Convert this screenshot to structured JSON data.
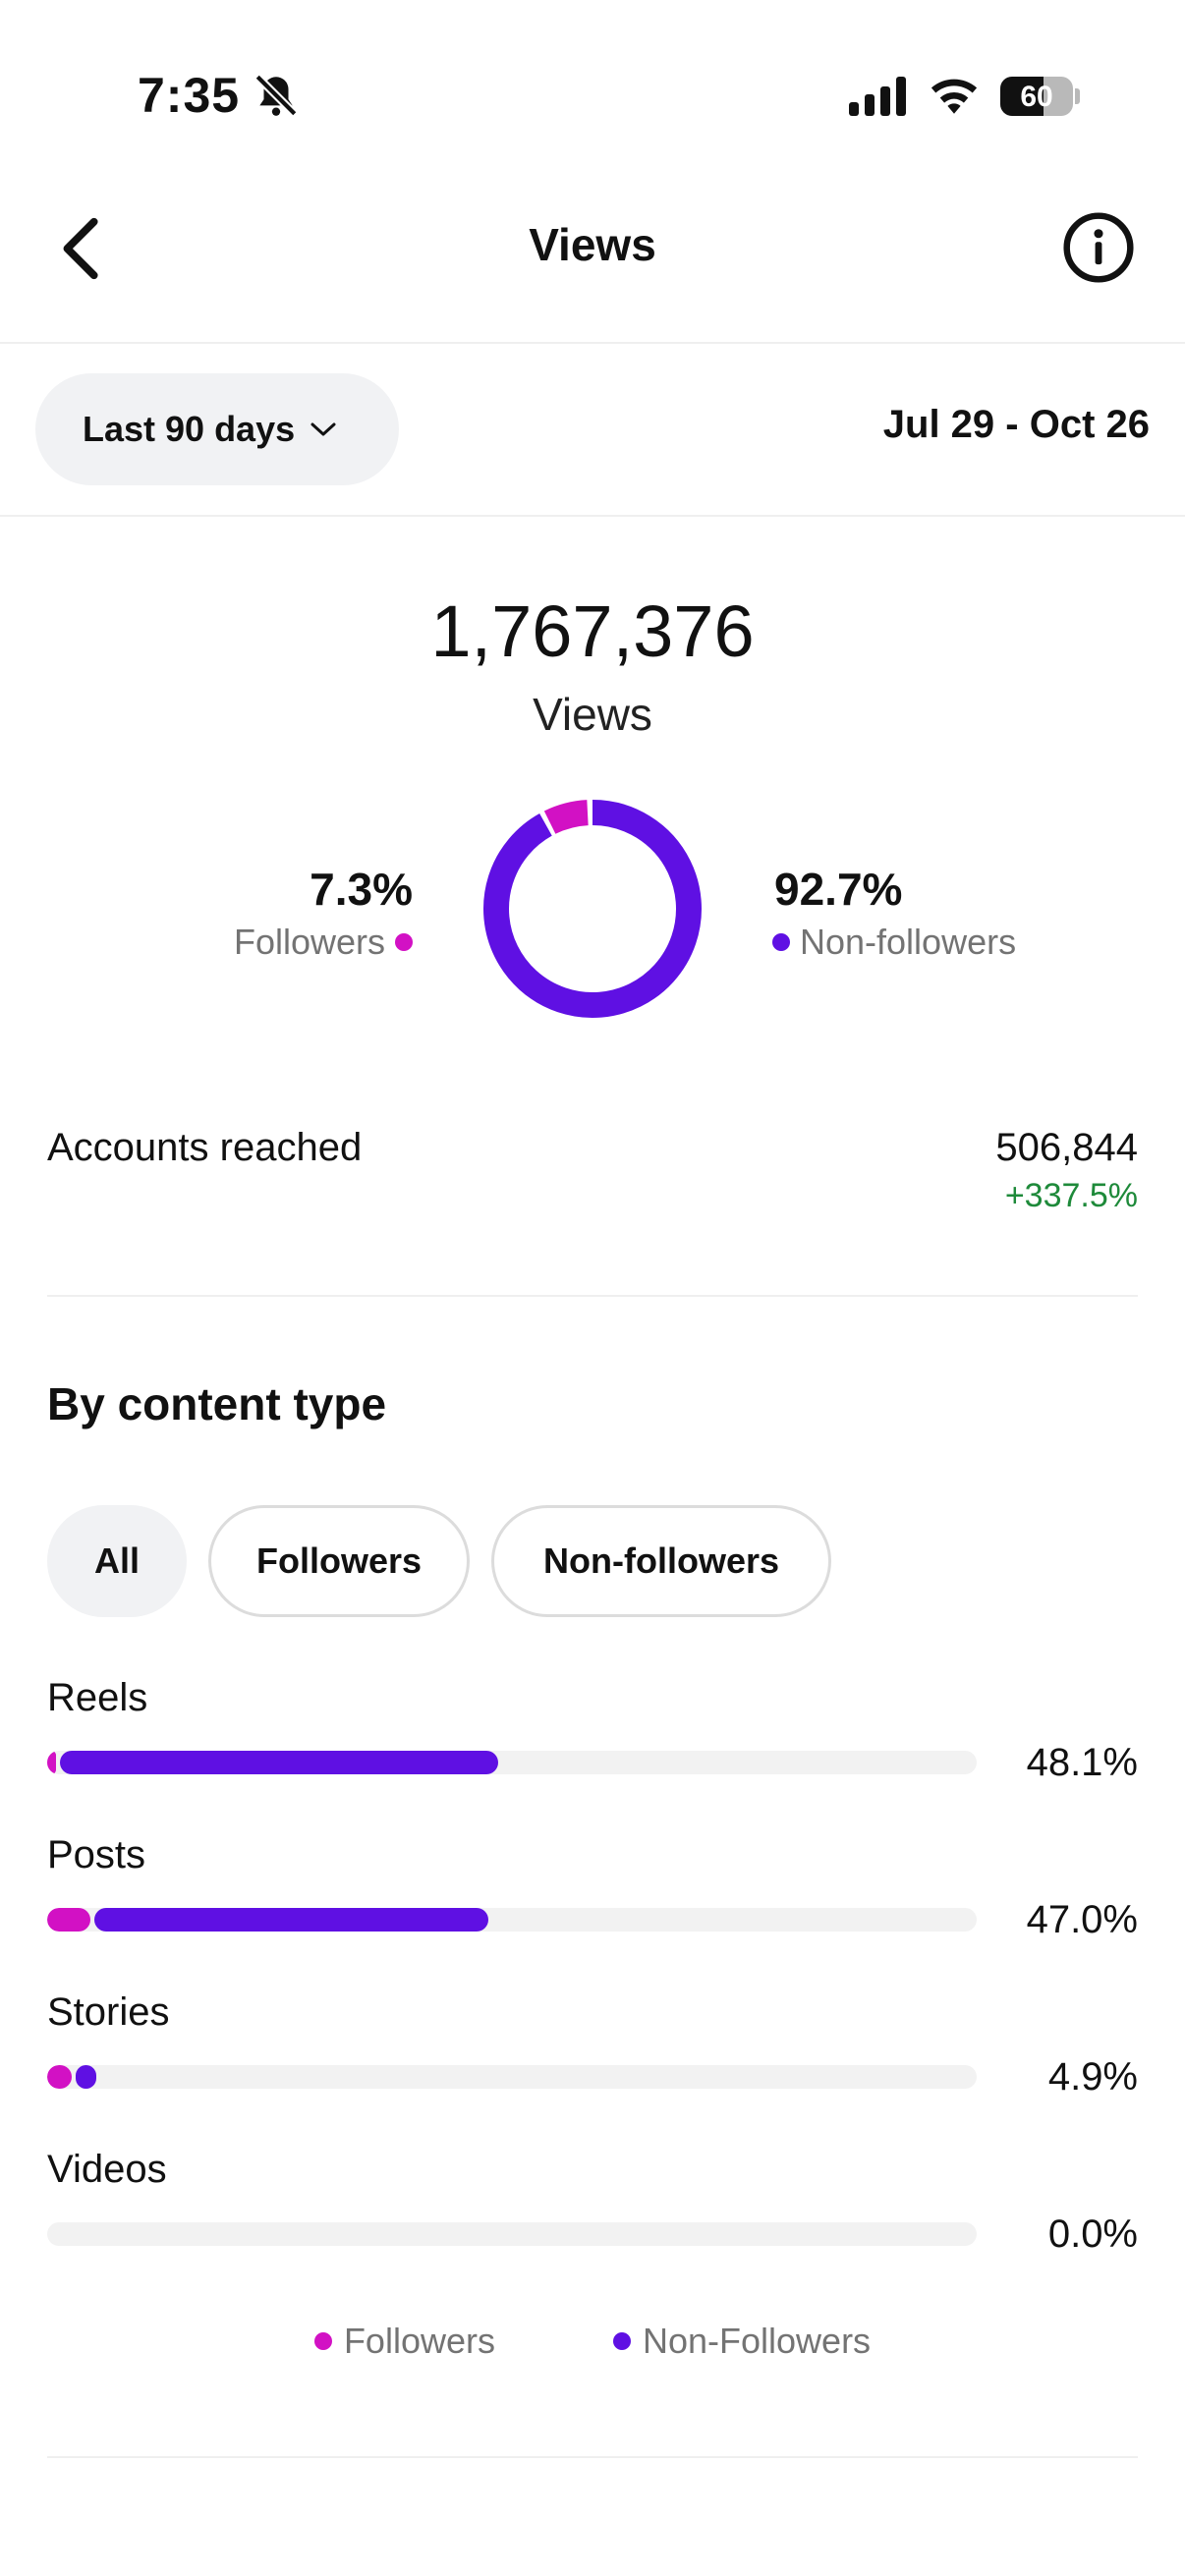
{
  "status_bar": {
    "time": "7:35",
    "battery": "60",
    "battery_level": 0.6
  },
  "header": {
    "title": "Views"
  },
  "filter": {
    "range_label": "Last 90 days",
    "date_range": "Jul 29 - Oct 26"
  },
  "summary": {
    "total_views": "1,767,376",
    "total_label": "Views",
    "followers_pct": "7.3%",
    "followers_label": "Followers",
    "non_followers_pct": "92.7%",
    "non_followers_label": "Non-followers"
  },
  "accounts": {
    "label": "Accounts reached",
    "value": "506,844",
    "change": "+337.5%"
  },
  "content_type": {
    "title": "By content type",
    "chips": [
      "All",
      "Followers",
      "Non-followers"
    ],
    "rows": [
      {
        "label": "Reels",
        "pct": "48.1%",
        "followers_frac": 0.01,
        "non_followers_frac": 0.471
      },
      {
        "label": "Posts",
        "pct": "47.0%",
        "followers_frac": 0.046,
        "non_followers_frac": 0.424
      },
      {
        "label": "Stories",
        "pct": "4.9%",
        "followers_frac": 0.026,
        "non_followers_frac": 0.023
      },
      {
        "label": "Videos",
        "pct": "0.0%",
        "followers_frac": 0,
        "non_followers_frac": 0
      }
    ],
    "legend": [
      "Followers",
      "Non-Followers"
    ]
  },
  "colors": {
    "followers": "#d211c4",
    "non_followers": "#5f10e3",
    "positive": "#1e8a3a"
  },
  "donut": {
    "followers_frac": 0.073,
    "non_followers_frac": 0.927
  }
}
